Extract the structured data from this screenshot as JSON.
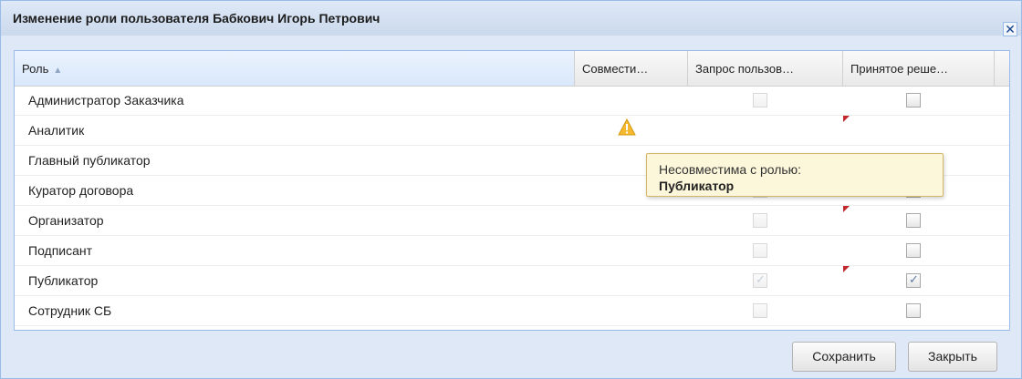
{
  "dialog": {
    "title": "Изменение роли пользователя Бабкович Игорь Петрович",
    "close_glyph": "✕"
  },
  "grid": {
    "columns": [
      {
        "label": "Роль",
        "sorted": "asc"
      },
      {
        "label": "Совмести…"
      },
      {
        "label": "Запрос пользов…"
      },
      {
        "label": "Принятое реше…"
      }
    ],
    "rows": [
      {
        "name": "Администратор Заказчика",
        "request": false,
        "decision": false,
        "warning": false,
        "dirty": false
      },
      {
        "name": "Аналитик",
        "request": null,
        "decision": null,
        "warning": true,
        "dirty": true
      },
      {
        "name": "Главный публикатор",
        "request": false,
        "decision": false,
        "warning": false,
        "dirty": false
      },
      {
        "name": "Куратор договора",
        "request": false,
        "decision": false,
        "warning": false,
        "dirty": false
      },
      {
        "name": "Организатор",
        "request": false,
        "decision": false,
        "warning": false,
        "dirty": true
      },
      {
        "name": "Подписант",
        "request": false,
        "decision": false,
        "warning": false,
        "dirty": false
      },
      {
        "name": "Публикатор",
        "request": true,
        "decision": true,
        "warning": false,
        "dirty": true
      },
      {
        "name": "Сотрудник СБ",
        "request": false,
        "decision": false,
        "warning": false,
        "dirty": false
      }
    ]
  },
  "tooltip": {
    "line1": "Несовместима с ролью:",
    "line2": "Публикатор"
  },
  "buttons": {
    "save": "Сохранить",
    "close": "Закрыть"
  },
  "icons": {
    "warning": "warning-icon",
    "check": "✓"
  }
}
